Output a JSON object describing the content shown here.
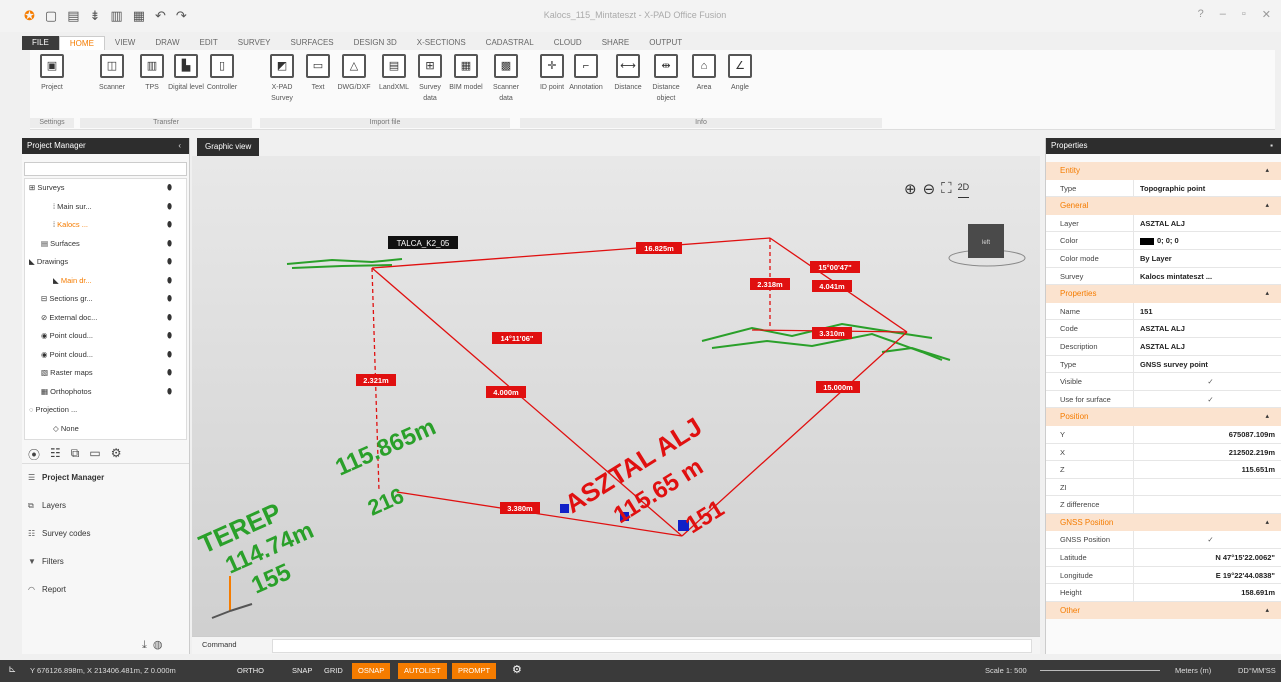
{
  "window": {
    "title": "Kalocs_115_Mintateszt - X-PAD Office Fusion",
    "controls": [
      "?",
      "–",
      "▫",
      "✕"
    ]
  },
  "menu_tabs": [
    "FILE",
    "HOME",
    "VIEW",
    "DRAW",
    "EDIT",
    "SURVEY",
    "SURFACES",
    "DESIGN 3D",
    "X-SECTIONS",
    "CADASTRAL",
    "CLOUD",
    "SHARE",
    "OUTPUT"
  ],
  "ribbon": {
    "buttons": [
      {
        "label": "Project",
        "icon": "project-icon"
      },
      {
        "label": "Scanner",
        "icon": "scanner-icon"
      },
      {
        "label": "TPS",
        "icon": "tps-icon"
      },
      {
        "label": "Digital level",
        "icon": "digital-level-icon"
      },
      {
        "label": "Controller",
        "icon": "controller-icon"
      },
      {
        "label": "X-PAD Survey",
        "icon": "xpad-survey-icon"
      },
      {
        "label": "Text",
        "icon": "text-file-icon"
      },
      {
        "label": "DWG/DXF",
        "icon": "dwg-icon"
      },
      {
        "label": "LandXML",
        "icon": "landxml-icon"
      },
      {
        "label": "Survey data",
        "icon": "survey-data-icon"
      },
      {
        "label": "BIM model",
        "icon": "bim-icon"
      },
      {
        "label": "Scanner data",
        "icon": "scanner-data-icon"
      },
      {
        "label": "ID point",
        "icon": "id-point-icon"
      },
      {
        "label": "Annotation",
        "icon": "annotation-icon"
      },
      {
        "label": "Distance",
        "icon": "distance-icon"
      },
      {
        "label": "Distance object",
        "icon": "distance-object-icon"
      },
      {
        "label": "Area",
        "icon": "area-icon"
      },
      {
        "label": "Angle",
        "icon": "angle-icon"
      }
    ],
    "groups": [
      "Settings",
      "Transfer",
      "Import file",
      "Info"
    ]
  },
  "project_manager": {
    "title": "Project Manager",
    "search_placeholder": "",
    "tree": [
      {
        "label": "Surveys",
        "indent": 0
      },
      {
        "label": "Main sur...",
        "indent": 2
      },
      {
        "label": "Kalocs ...",
        "indent": 2,
        "selected": true
      },
      {
        "label": "Surfaces",
        "indent": 1
      },
      {
        "label": "Drawings",
        "indent": 0
      },
      {
        "label": "Main dr...",
        "indent": 2,
        "selected": true
      },
      {
        "label": "Sections gr...",
        "indent": 1
      },
      {
        "label": "External doc...",
        "indent": 1
      },
      {
        "label": "Point cloud...",
        "indent": 1
      },
      {
        "label": "Point cloud...",
        "indent": 1
      },
      {
        "label": "Raster maps",
        "indent": 1
      },
      {
        "label": "Orthophotos",
        "indent": 1
      },
      {
        "label": "Projection ...",
        "indent": 0
      },
      {
        "label": "None",
        "indent": 2
      }
    ],
    "nav": [
      "Project Manager",
      "Layers",
      "Survey codes",
      "Filters",
      "Report"
    ]
  },
  "graphic_view": {
    "tab": "Graphic view",
    "zoom_2d_label": "2D",
    "cube_label": "left",
    "point_tag": "TALCA_K2_05",
    "measure_labels": [
      "16.825m",
      "15°00'47\"",
      "2.318m",
      "4.041m",
      "3.310m",
      "14°11'06\"",
      "2.321m",
      "4.000m",
      "15.000m",
      "3.380m"
    ],
    "big_labels": {
      "left_name": "TEREP",
      "left_height": "114.74m",
      "left_code": "155",
      "left_extra": "115.865m",
      "left_num": "216",
      "right_name": "ASZTAL ALJ",
      "right_height": "115.65 m",
      "right_num": "151"
    },
    "command_label": "Command",
    "command_value": ""
  },
  "properties": {
    "title": "Properties",
    "sections": [
      {
        "name": "Entity",
        "rows": [
          {
            "k": "Type",
            "v": "Topographic point"
          }
        ]
      },
      {
        "name": "General",
        "rows": [
          {
            "k": "Layer",
            "v": "ASZTAL ALJ"
          },
          {
            "k": "Color",
            "v": "0; 0; 0",
            "swatch": true
          },
          {
            "k": "Color mode",
            "v": "By Layer"
          },
          {
            "k": "Survey",
            "v": "Kalocs mintateszt ..."
          }
        ]
      },
      {
        "name": "Properties",
        "rows": [
          {
            "k": "Name",
            "v": "151"
          },
          {
            "k": "Code",
            "v": "ASZTAL ALJ"
          },
          {
            "k": "Description",
            "v": "ASZTAL ALJ"
          },
          {
            "k": "Type",
            "v": "GNSS survey point"
          },
          {
            "k": "Visible",
            "v": "✓",
            "check": true
          },
          {
            "k": "Use for surface",
            "v": "✓",
            "check": true
          }
        ]
      },
      {
        "name": "Position",
        "rows": [
          {
            "k": "Y",
            "v": "675087.109m",
            "right": true
          },
          {
            "k": "X",
            "v": "212502.219m",
            "right": true
          },
          {
            "k": "Z",
            "v": "115.651m",
            "right": true
          },
          {
            "k": "ZI",
            "v": ""
          },
          {
            "k": "Z difference",
            "v": ""
          }
        ]
      },
      {
        "name": "GNSS Position",
        "rows": [
          {
            "k": "GNSS Position",
            "v": "✓",
            "check": true
          },
          {
            "k": "Latitude",
            "v": "N 47°15'22.0062\"",
            "right": true
          },
          {
            "k": "Longitude",
            "v": "E 19°22'44.0838\"",
            "right": true
          },
          {
            "k": "Height",
            "v": "158.691m",
            "right": true
          }
        ]
      },
      {
        "name": "Other",
        "rows": []
      }
    ]
  },
  "statusbar": {
    "coords": "Y 676126.898m, X 213406.481m, Z 0.000m",
    "toggles": [
      {
        "label": "ORTHO",
        "on": false
      },
      {
        "label": "SNAP",
        "on": false
      },
      {
        "label": "GRID",
        "on": false
      },
      {
        "label": "OSNAP",
        "on": true
      },
      {
        "label": "AUTOLIST",
        "on": true
      },
      {
        "label": "PROMPT",
        "on": true
      }
    ],
    "scale": "Scale 1: 500",
    "units": "Meters (m)",
    "angle_units": "DD°MM'SS"
  },
  "colors": {
    "accent": "#f57c00",
    "measure": "#e01010",
    "dark_header": "#2d2d2d",
    "green_text": "#2aa02a"
  }
}
